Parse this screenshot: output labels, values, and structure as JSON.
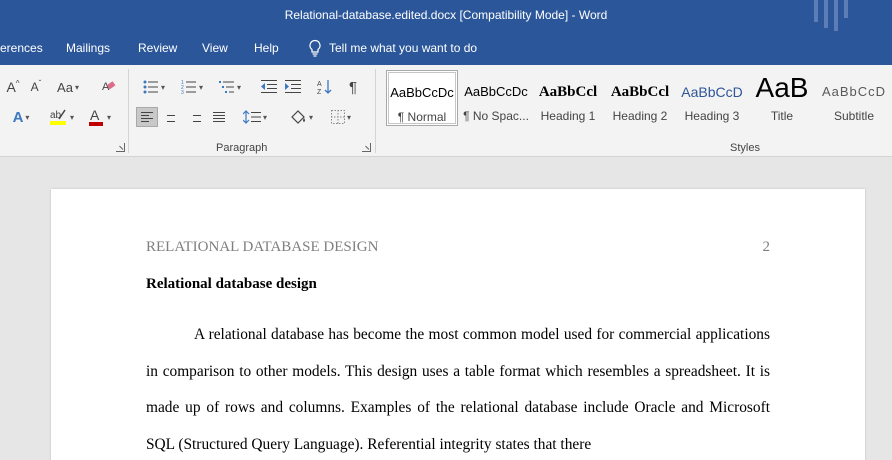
{
  "window": {
    "title": "Relational-database.edited.docx [Compatibility Mode]  -  Word"
  },
  "tabs": {
    "references": "erences",
    "mailings": "Mailings",
    "review": "Review",
    "view": "View",
    "help": "Help",
    "tell_me": "Tell me what you want to do"
  },
  "ribbon": {
    "font_grow": "A",
    "font_shrink": "A",
    "change_case": "Aa",
    "text_effects": "A",
    "font_color": "A",
    "paragraph_label": "Paragraph",
    "styles_label": "Styles",
    "highlight_color": "#ffff00",
    "font_color_value": "#c00000",
    "styles": [
      {
        "sample": "AaBbCcDc",
        "name": "¶ Normal"
      },
      {
        "sample": "AaBbCcDc",
        "name": "¶ No Spac..."
      },
      {
        "sample": "AaBbCcl",
        "name": "Heading 1"
      },
      {
        "sample": "AaBbCcl",
        "name": "Heading 2"
      },
      {
        "sample": "AaBbCcD",
        "name": "Heading 3"
      },
      {
        "sample": "AaB",
        "name": "Title"
      },
      {
        "sample": "AaBbCcD",
        "name": "Subtitle"
      }
    ]
  },
  "document": {
    "running_header": "RELATIONAL DATABASE DESIGN",
    "page_number": "2",
    "heading": "Relational database design",
    "paragraph": "A relational database has become the most common model used for commercial applications in comparison to other models. This design uses a table format which resembles a spreadsheet. It is made up of rows and columns. Examples of the relational database include Oracle and Microsoft SQL (Structured Query Language). Referential integrity states that there"
  }
}
